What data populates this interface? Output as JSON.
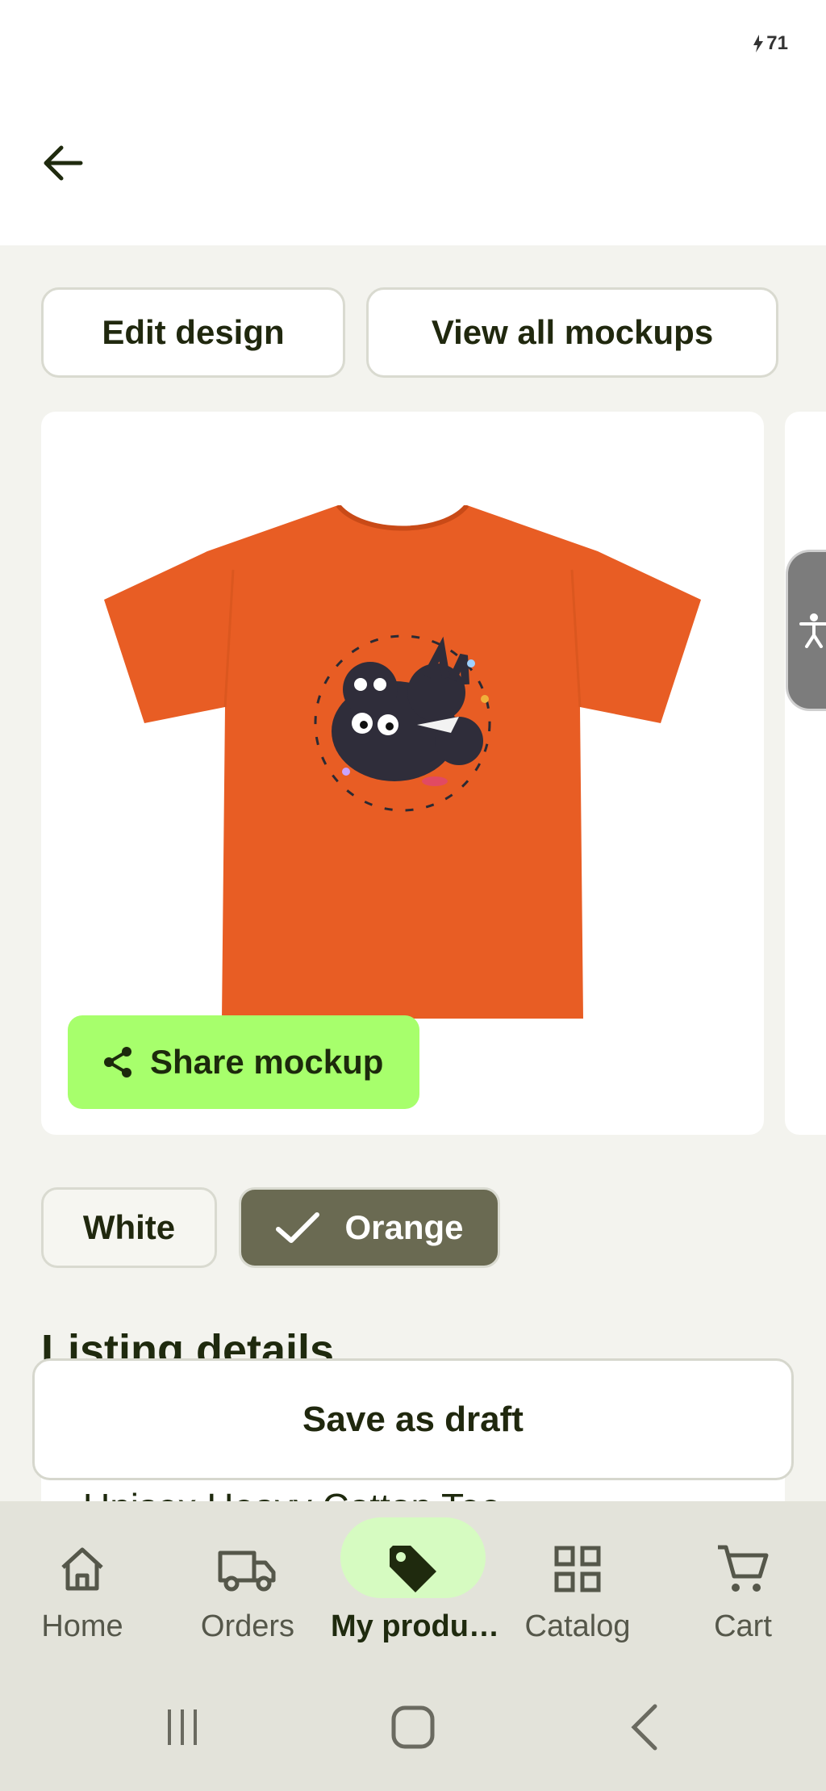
{
  "status_bar": {
    "battery": "71"
  },
  "header": {
    "back_icon": "arrow-left-icon"
  },
  "actions": {
    "edit_design": "Edit design",
    "view_all_mockups": "View all mockups"
  },
  "mockup": {
    "shirt_color": "#e85d24",
    "share_label": "Share mockup",
    "share_color": "#a7ff6c"
  },
  "colors": {
    "options": [
      {
        "label": "White",
        "selected": false
      },
      {
        "label": "Orange",
        "selected": true
      }
    ]
  },
  "listing": {
    "section_title": "Listing details",
    "product_title_preview": "Unisex Heavy Cotton Tee"
  },
  "save_draft": "Save as draft",
  "bottom_nav": {
    "items": [
      {
        "label": "Home",
        "icon": "home-icon",
        "active": false
      },
      {
        "label": "Orders",
        "icon": "truck-icon",
        "active": false
      },
      {
        "label": "My produ…",
        "icon": "tag-icon",
        "active": true
      },
      {
        "label": "Catalog",
        "icon": "grid-icon",
        "active": false
      },
      {
        "label": "Cart",
        "icon": "cart-icon",
        "active": false
      }
    ]
  },
  "system_nav": {
    "recents": "recents-icon",
    "home": "home-button-icon",
    "back": "back-chevron-icon"
  }
}
